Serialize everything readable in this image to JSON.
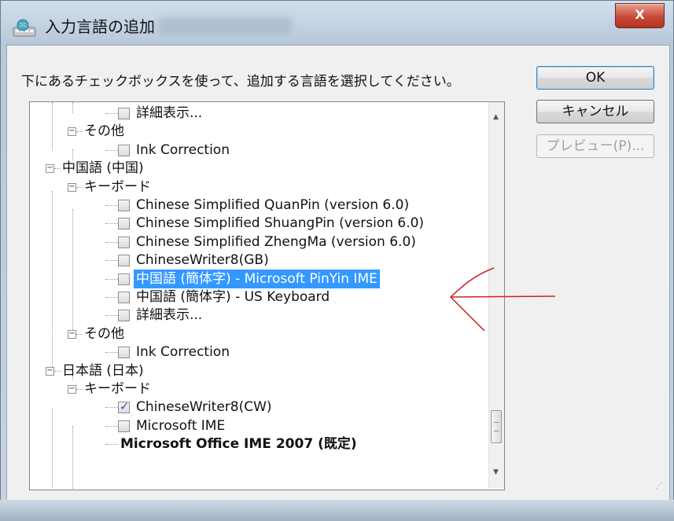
{
  "window": {
    "title": "入力言語の追加",
    "close_label": "X"
  },
  "instruction": "下にあるチェックボックスを使って、追加する言語を選択してください。",
  "buttons": {
    "ok": "OK",
    "cancel": "キャンセル",
    "preview": "プレビュー(P)..."
  },
  "tree": {
    "rows": [
      {
        "label": "詳細表示...",
        "kind": "checkbox",
        "checked": false
      },
      {
        "label": "その他",
        "kind": "group"
      },
      {
        "label": "Ink Correction",
        "kind": "checkbox",
        "checked": false
      },
      {
        "label": "中国語 (中国)",
        "kind": "language"
      },
      {
        "label": "キーボード",
        "kind": "group"
      },
      {
        "label": "Chinese Simplified QuanPin (version 6.0)",
        "kind": "checkbox",
        "checked": false
      },
      {
        "label": "Chinese Simplified ShuangPin (version 6.0)",
        "kind": "checkbox",
        "checked": false
      },
      {
        "label": "Chinese Simplified ZhengMa (version 6.0)",
        "kind": "checkbox",
        "checked": false
      },
      {
        "label": "ChineseWriter8(GB)",
        "kind": "checkbox",
        "checked": false
      },
      {
        "label": "中国語 (簡体字) - Microsoft PinYin IME",
        "kind": "checkbox",
        "checked": false,
        "selected": true
      },
      {
        "label": "中国語 (簡体字) - US Keyboard",
        "kind": "checkbox",
        "checked": false
      },
      {
        "label": "詳細表示...",
        "kind": "checkbox",
        "checked": false
      },
      {
        "label": "その他",
        "kind": "group"
      },
      {
        "label": "Ink Correction",
        "kind": "checkbox",
        "checked": false
      },
      {
        "label": "日本語 (日本)",
        "kind": "language"
      },
      {
        "label": "キーボード",
        "kind": "group"
      },
      {
        "label": "ChineseWriter8(CW)",
        "kind": "checkbox",
        "checked": true
      },
      {
        "label": "Microsoft IME",
        "kind": "checkbox",
        "checked": false
      },
      {
        "label": "Microsoft Office IME 2007 (既定)",
        "kind": "default"
      }
    ],
    "scroll": {
      "up_icon": "triangle-up-icon",
      "down_icon": "triangle-down-icon"
    }
  },
  "annotation": {
    "color": "#cc2222",
    "icon": "red-arrow-annotation"
  }
}
